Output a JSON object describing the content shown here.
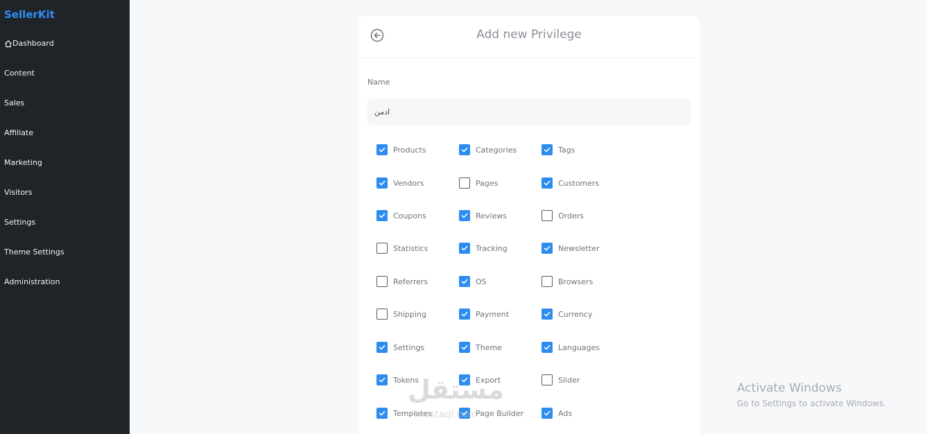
{
  "sidebar": {
    "brand": "SellerKit",
    "items": [
      {
        "label": "Dashboard",
        "icon": "home-icon"
      },
      {
        "label": "Content"
      },
      {
        "label": "Sales"
      },
      {
        "label": "Affiliate"
      },
      {
        "label": "Marketing"
      },
      {
        "label": "Visitors"
      },
      {
        "label": "Settings"
      },
      {
        "label": "Theme Settings"
      },
      {
        "label": "Administration"
      }
    ]
  },
  "form": {
    "title": "Add new Privilege",
    "name_label": "Name",
    "name_value": "ادمن",
    "permissions": [
      {
        "label": "Products",
        "checked": true
      },
      {
        "label": "Categories",
        "checked": true
      },
      {
        "label": "Tags",
        "checked": true
      },
      {
        "label": "Vendors",
        "checked": true
      },
      {
        "label": "Pages",
        "checked": false
      },
      {
        "label": "Customers",
        "checked": true
      },
      {
        "label": "Coupons",
        "checked": true
      },
      {
        "label": "Reviews",
        "checked": true
      },
      {
        "label": "Orders",
        "checked": false
      },
      {
        "label": "Statistics",
        "checked": false
      },
      {
        "label": "Tracking",
        "checked": true
      },
      {
        "label": "Newsletter",
        "checked": true
      },
      {
        "label": "Referrers",
        "checked": false
      },
      {
        "label": "OS",
        "checked": true
      },
      {
        "label": "Browsers",
        "checked": false
      },
      {
        "label": "Shipping",
        "checked": false
      },
      {
        "label": "Payment",
        "checked": true
      },
      {
        "label": "Currency",
        "checked": true
      },
      {
        "label": "Settings",
        "checked": true
      },
      {
        "label": "Theme",
        "checked": true
      },
      {
        "label": "Languages",
        "checked": true
      },
      {
        "label": "Tokens",
        "checked": true
      },
      {
        "label": "Export",
        "checked": true
      },
      {
        "label": "Slider",
        "checked": false
      },
      {
        "label": "Templates",
        "checked": true
      },
      {
        "label": "Page Builder",
        "checked": true
      },
      {
        "label": "Ads",
        "checked": true
      }
    ]
  },
  "watermark": {
    "text": "مستقل",
    "sub": "mostaql.com"
  },
  "windows_notice": {
    "title": "Activate Windows",
    "subtitle": "Go to Settings to activate Windows."
  },
  "colors": {
    "accent": "#2d8cf0",
    "sidebar_bg": "#1f2429",
    "brand": "#2f8df5"
  }
}
